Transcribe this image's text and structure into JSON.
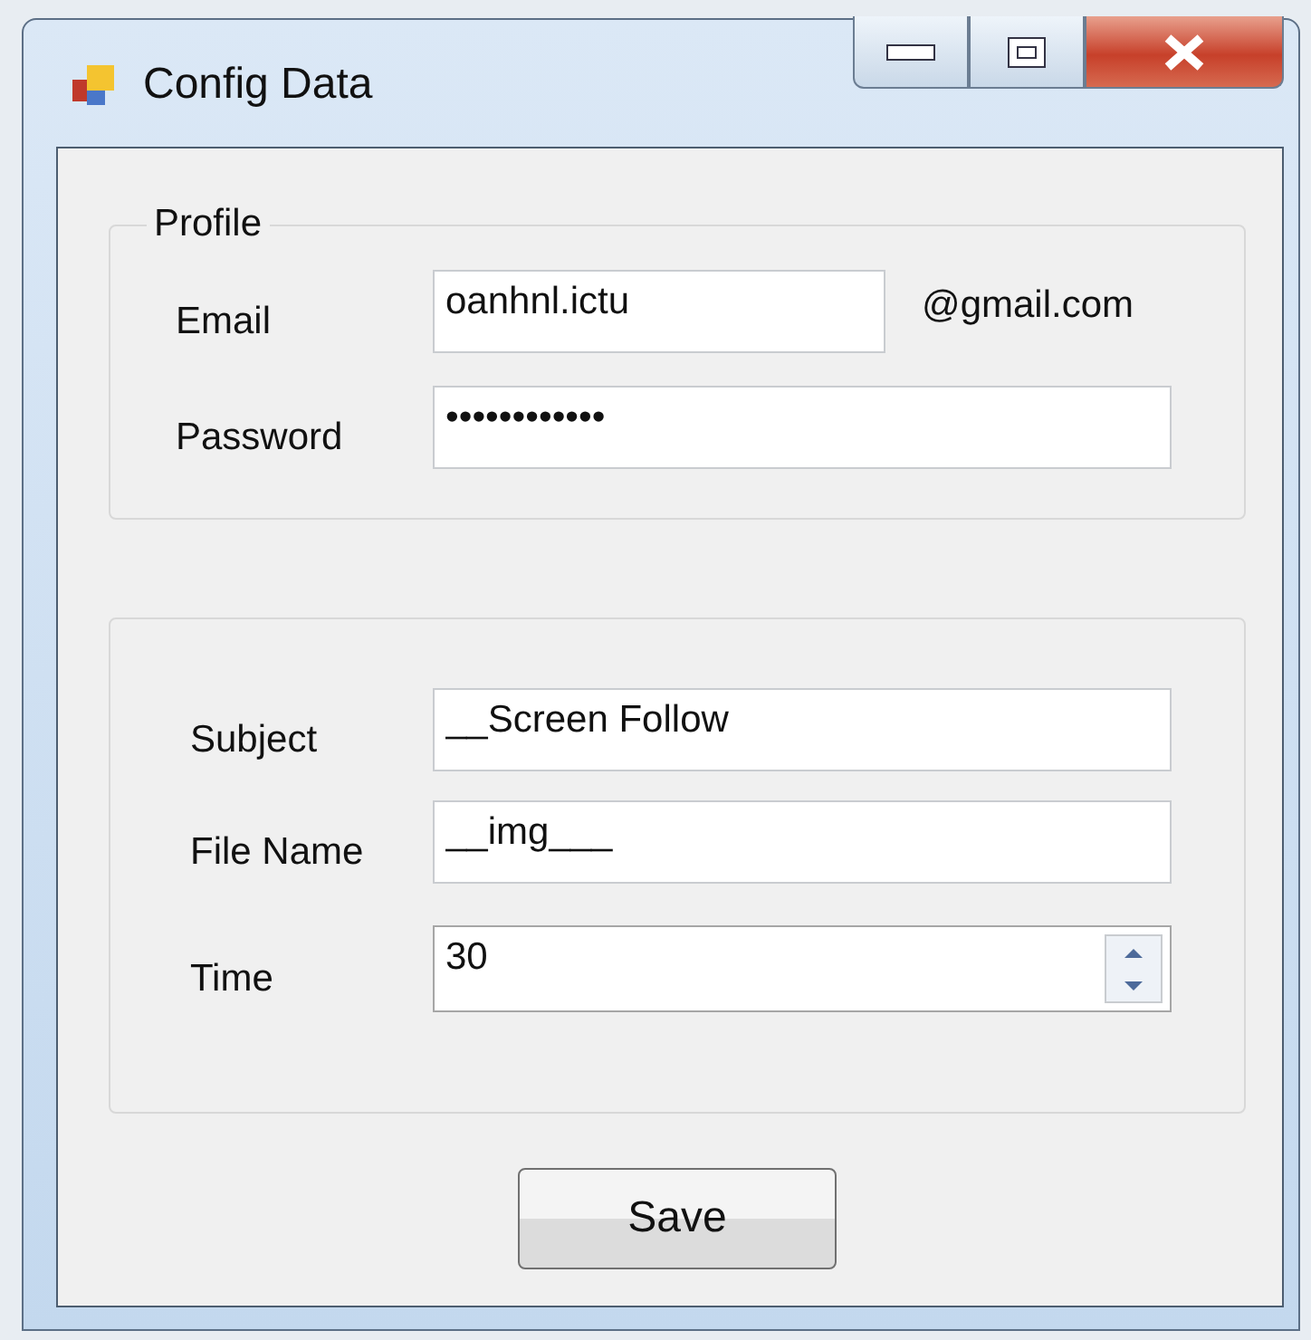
{
  "window": {
    "title": "Config Data"
  },
  "profile": {
    "title": "Profile",
    "fields": [
      {
        "label": "Email",
        "value": "oanhnl.ictu",
        "suffix": "@gmail.com"
      },
      {
        "label": "Password",
        "value": "••••••••••••"
      }
    ]
  },
  "settings": {
    "fields": [
      {
        "label": "Subject",
        "value": "__Screen Follow",
        "kind": "text"
      },
      {
        "label": "File Name",
        "value": "__img___",
        "kind": "text"
      },
      {
        "label": "Time",
        "value": "30",
        "kind": "spin"
      }
    ]
  },
  "buttons": [
    "Save"
  ]
}
